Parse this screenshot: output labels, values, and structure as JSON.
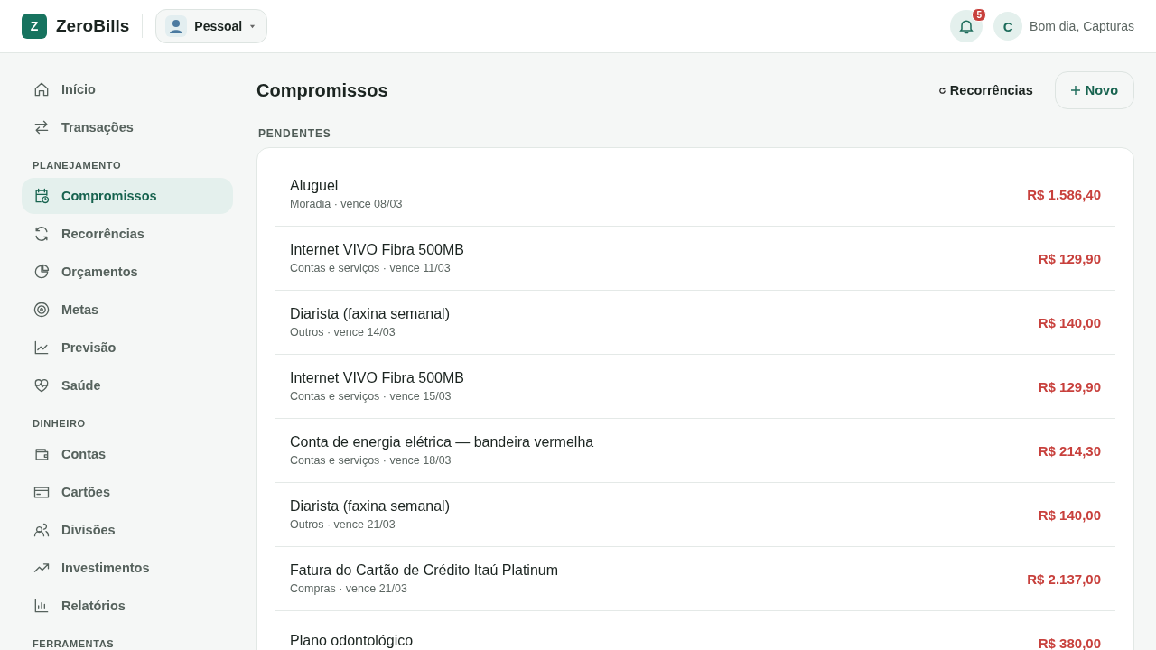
{
  "brand": {
    "logo": "Z",
    "name": "ZeroBills"
  },
  "profile_switcher": {
    "label": "Pessoal"
  },
  "notifications": {
    "count": "5"
  },
  "user": {
    "initial": "C",
    "greeting": "Bom dia, Capturas"
  },
  "sidebar": {
    "sections": [
      {
        "items": [
          {
            "label": "Início",
            "kind": "home",
            "selected": false
          },
          {
            "label": "Transações",
            "kind": "swap",
            "selected": false
          }
        ]
      },
      {
        "title": "PLANEJAMENTO",
        "items": [
          {
            "label": "Compromissos",
            "kind": "calendar",
            "selected": true
          },
          {
            "label": "Recorrências",
            "kind": "refresh",
            "selected": false
          },
          {
            "label": "Orçamentos",
            "kind": "pie",
            "selected": false
          },
          {
            "label": "Metas",
            "kind": "target",
            "selected": false
          },
          {
            "label": "Previsão",
            "kind": "chart",
            "selected": false
          },
          {
            "label": "Saúde",
            "kind": "heart",
            "selected": false
          }
        ]
      },
      {
        "title": "DINHEIRO",
        "items": [
          {
            "label": "Contas",
            "kind": "wallet",
            "selected": false
          },
          {
            "label": "Cartões",
            "kind": "card",
            "selected": false
          },
          {
            "label": "Divisões",
            "kind": "users",
            "selected": false
          },
          {
            "label": "Investimentos",
            "kind": "trend",
            "selected": false
          },
          {
            "label": "Relatórios",
            "kind": "bars",
            "selected": false
          }
        ]
      },
      {
        "title": "FERRAMENTAS"
      }
    ]
  },
  "page": {
    "title": "Compromissos",
    "recurrences_link": "Recorrências",
    "new_button": "Novo",
    "section": "PENDENTES"
  },
  "commitments": [
    {
      "name": "Aluguel",
      "detail": "Moradia · vence 08/03",
      "amount": "R$ 1.586,40"
    },
    {
      "name": "Internet VIVO Fibra 500MB",
      "detail": "Contas e serviços · vence 11/03",
      "amount": "R$ 129,90"
    },
    {
      "name": "Diarista (faxina semanal)",
      "detail": "Outros · vence 14/03",
      "amount": "R$ 140,00"
    },
    {
      "name": "Internet VIVO Fibra 500MB",
      "detail": "Contas e serviços · vence 15/03",
      "amount": "R$ 129,90"
    },
    {
      "name": "Conta de energia elétrica — bandeira vermelha",
      "detail": "Contas e serviços · vence 18/03",
      "amount": "R$ 214,30"
    },
    {
      "name": "Diarista (faxina semanal)",
      "detail": "Outros · vence 21/03",
      "amount": "R$ 140,00"
    },
    {
      "name": "Fatura do Cartão de Crédito Itaú Platinum",
      "detail": "Compras · vence 21/03",
      "amount": "R$ 2.137,00"
    },
    {
      "name": "Plano odontológico",
      "amount": "R$ 380,00"
    }
  ]
}
